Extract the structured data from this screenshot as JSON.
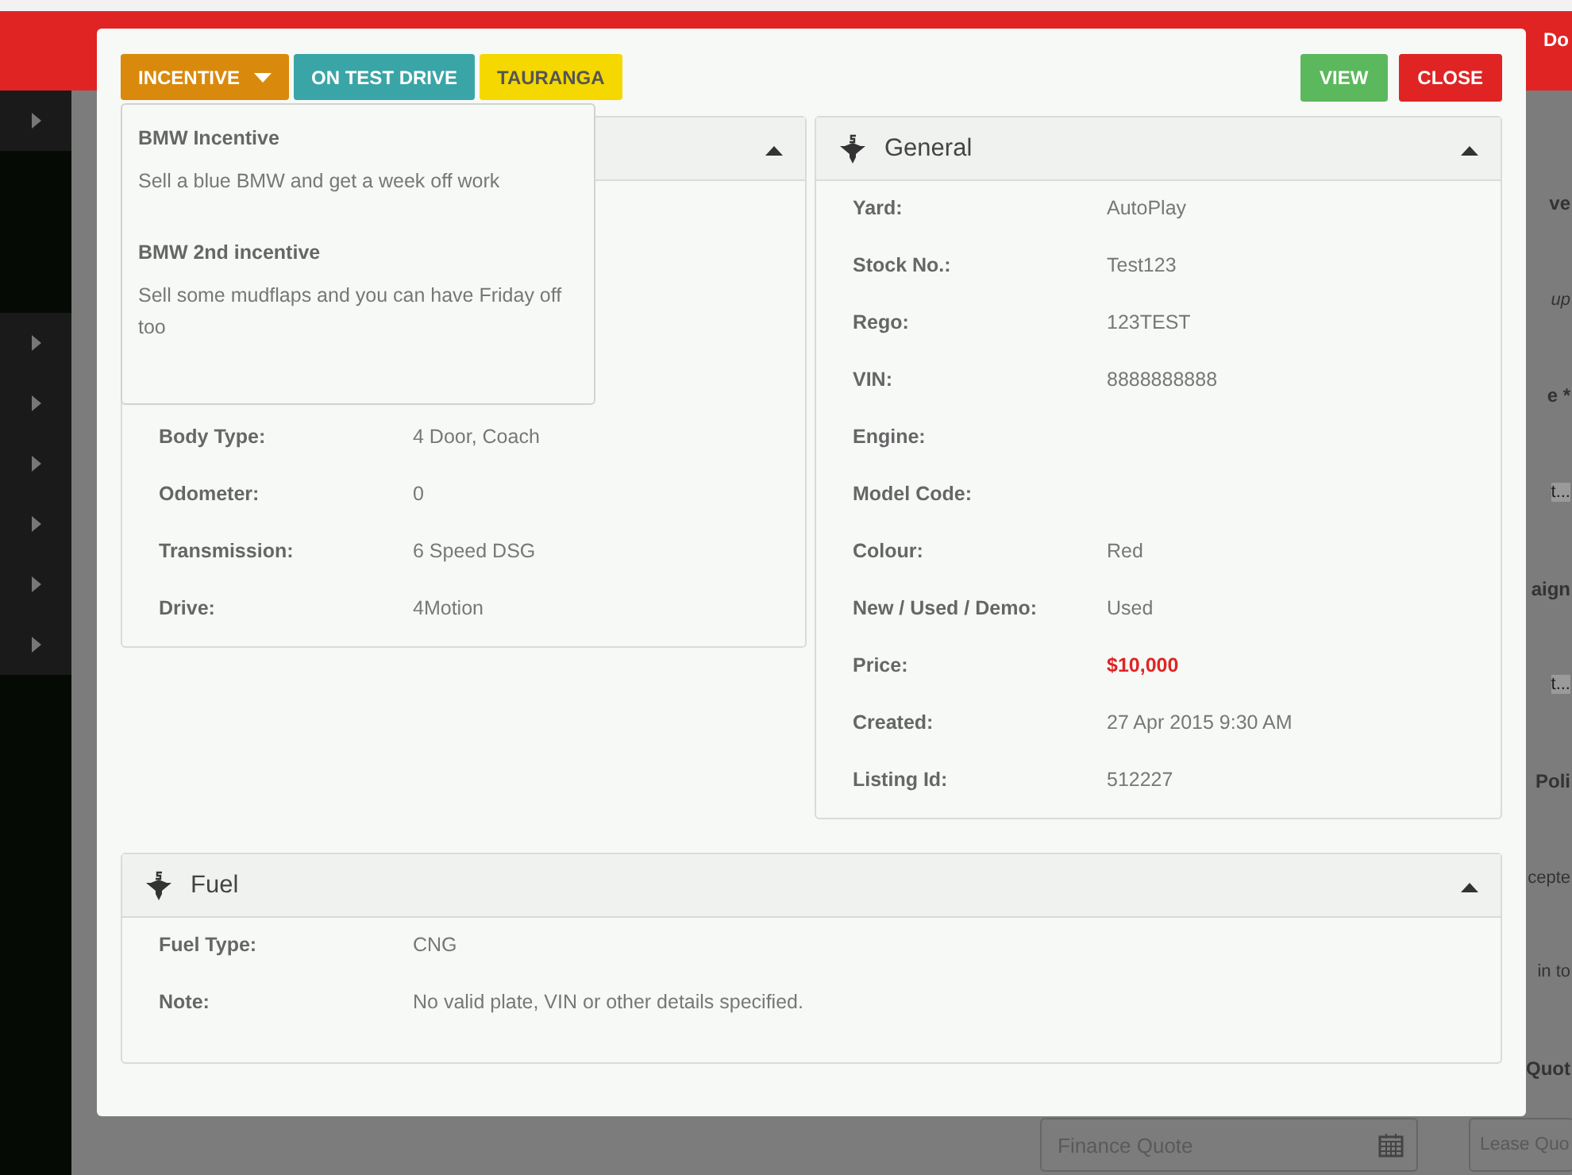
{
  "background": {
    "header_text": "Do",
    "side_items": [
      {
        "expanded": false
      },
      {
        "expanded": false
      },
      {
        "expanded": false
      },
      {
        "expanded": false
      },
      {
        "expanded": false
      },
      {
        "expanded": false
      },
      {
        "expanded": false
      }
    ],
    "right_fragments": [
      {
        "text": "ve",
        "kind": "heading"
      },
      {
        "text": "up",
        "kind": "italic"
      },
      {
        "text": "e *",
        "kind": "heading"
      },
      {
        "text": "t...",
        "kind": "hint"
      },
      {
        "text": "aign",
        "kind": "heading"
      },
      {
        "text": "t...",
        "kind": "hint"
      },
      {
        "text": "Poli",
        "kind": "heading"
      },
      {
        "text": "cepte",
        "kind": "body"
      },
      {
        "text": "in to",
        "kind": "body"
      },
      {
        "text": "Quot",
        "kind": "heading"
      }
    ],
    "fields": [
      {
        "placeholder": "Finance Quote",
        "kind": "date"
      },
      {
        "placeholder": "Lease Quo",
        "kind": "text"
      }
    ]
  },
  "modal": {
    "badges": [
      {
        "label": "INCENTIVE",
        "kind": "dropdown",
        "color": "#d98a0c",
        "expanded": true
      },
      {
        "label": "ON TEST DRIVE",
        "kind": "plain",
        "color": "#3aa5a7"
      },
      {
        "label": "TAURANGA",
        "kind": "plain",
        "color": "#f5d800"
      }
    ],
    "actions": [
      {
        "label": "VIEW",
        "color": "#5cb85c"
      },
      {
        "label": "CLOSE",
        "color": "#e02424"
      }
    ],
    "incentives": [
      {
        "title": "BMW Incentive",
        "text": "Sell a blue BMW and get a week off work"
      },
      {
        "title": "BMW 2nd incentive",
        "text": "Sell some mudflaps and you can have Friday off too"
      }
    ],
    "left_panel": {
      "expanded": true,
      "rows": [
        {
          "label": "Body Type:",
          "value": "4 Door, Coach"
        },
        {
          "label": "Odometer:",
          "value": "0"
        },
        {
          "label": "Transmission:",
          "value": "6 Speed DSG"
        },
        {
          "label": "Drive:",
          "value": "4Motion"
        }
      ]
    },
    "general": {
      "title": "General",
      "expanded": true,
      "rows": [
        {
          "label": "Yard:",
          "value": "AutoPlay"
        },
        {
          "label": "Stock No.:",
          "value": "Test123"
        },
        {
          "label": "Rego:",
          "value": "123TEST"
        },
        {
          "label": "VIN:",
          "value": "8888888888"
        },
        {
          "label": "Engine:"
        },
        {
          "label": "Model Code:"
        },
        {
          "label": "Colour:",
          "value": "Red"
        },
        {
          "label": "New / Used / Demo:",
          "value": "Used"
        },
        {
          "label": "Price:",
          "value": "$10,000",
          "kind": "price"
        },
        {
          "label": "Created:",
          "value": "27 Apr 2015 9:30 AM"
        },
        {
          "label": "Listing Id:",
          "value": "512227"
        }
      ]
    },
    "fuel": {
      "title": "Fuel",
      "expanded": true,
      "rows": [
        {
          "label": "Fuel Type:",
          "value": "CNG"
        },
        {
          "label": "Note:",
          "value": "No valid plate, VIN or other details specified."
        }
      ]
    }
  }
}
